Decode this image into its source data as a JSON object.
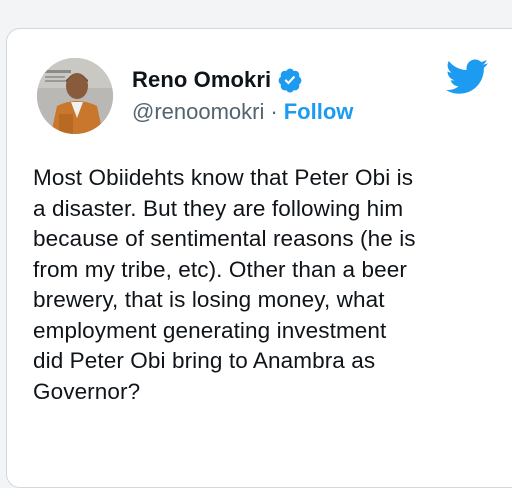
{
  "author": {
    "display_name": "Reno Omokri",
    "handle": "@renoomokri",
    "separator": "·",
    "follow_label": "Follow",
    "verified_icon": "verified-badge-icon",
    "avatar_icon": "profile-photo"
  },
  "brand": {
    "logo_icon": "twitter-bird-icon",
    "accent_color": "#1d9bf0"
  },
  "tweet": {
    "text": "Most Obiidehts know that Peter Obi is\na disaster. But they are following him\nbecause of sentimental reasons (he is\nfrom my tribe, etc). Other than a beer\nbrewery, that is losing money, what\nemployment generating investment\ndid Peter Obi bring to Anambra as\nGovernor?"
  }
}
